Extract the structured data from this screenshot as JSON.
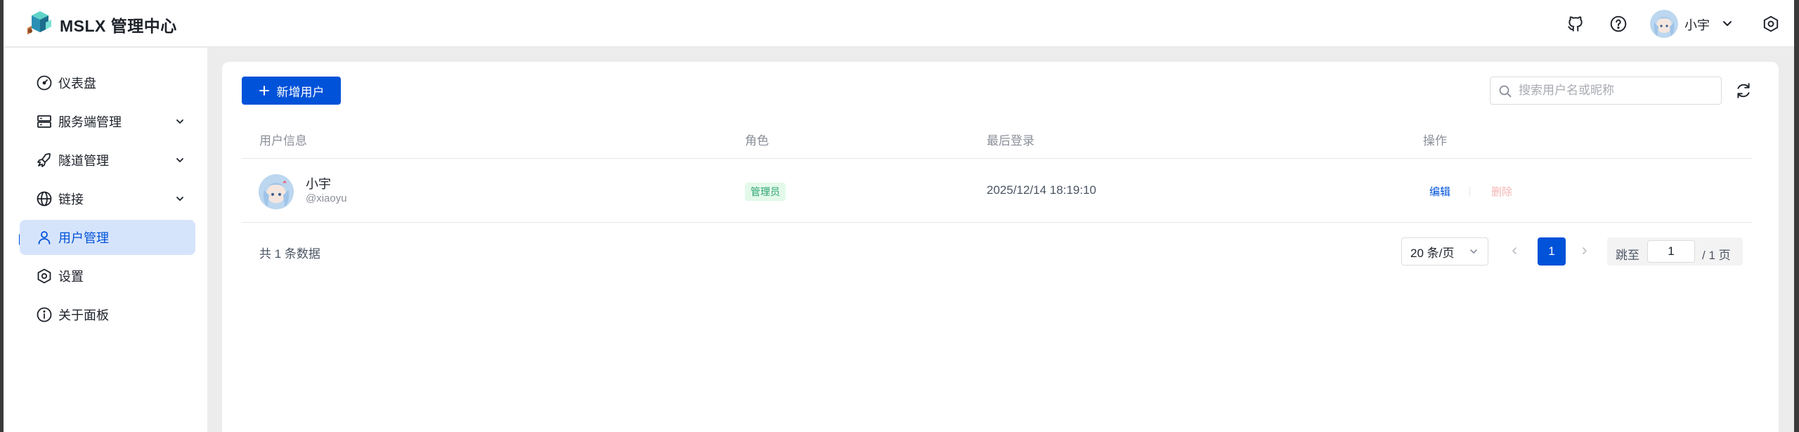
{
  "header": {
    "app_title": "MSLX 管理中心",
    "icons": [
      "github-icon",
      "help-icon",
      "settings-icon"
    ],
    "user": {
      "name": "小宇",
      "avatar": "avatar-image"
    }
  },
  "sidebar": {
    "items": [
      {
        "label": "仪表盘",
        "icon": "dashboard-icon",
        "expandable": false,
        "active": false
      },
      {
        "label": "服务端管理",
        "icon": "server-icon",
        "expandable": true,
        "active": false
      },
      {
        "label": "隧道管理",
        "icon": "rocket-icon",
        "expandable": true,
        "active": false
      },
      {
        "label": "链接",
        "icon": "globe-icon",
        "expandable": true,
        "active": false
      },
      {
        "label": "用户管理",
        "icon": "user-icon",
        "expandable": false,
        "active": true
      },
      {
        "label": "设置",
        "icon": "settings-icon",
        "expandable": false,
        "active": false
      },
      {
        "label": "关于面板",
        "icon": "info-icon",
        "expandable": false,
        "active": false
      }
    ]
  },
  "toolbar": {
    "add_button": "新增用户",
    "search_placeholder": "搜索用户名或昵称",
    "search_value": ""
  },
  "table": {
    "columns": [
      "用户信息",
      "角色",
      "最后登录",
      "操作"
    ],
    "rows": [
      {
        "name": "小宇",
        "handle": "@xiaoyu",
        "role": "管理员",
        "last_login": "2025/12/14 18:19:10",
        "actions": [
          "编辑",
          "删除"
        ]
      }
    ]
  },
  "pagination": {
    "total_text": "共 1 条数据",
    "page_size": "20 条/页",
    "current_page": "1",
    "jump_label": "跳至",
    "jump_value": "1",
    "total_pages": "/ 1 页"
  },
  "colors": {
    "primary": "#0052d9",
    "active_bg": "#d6e4fb",
    "tag_bg": "#e3f9e9",
    "tag_text": "#2ba471",
    "danger_disabled": "#f6b3b3"
  }
}
